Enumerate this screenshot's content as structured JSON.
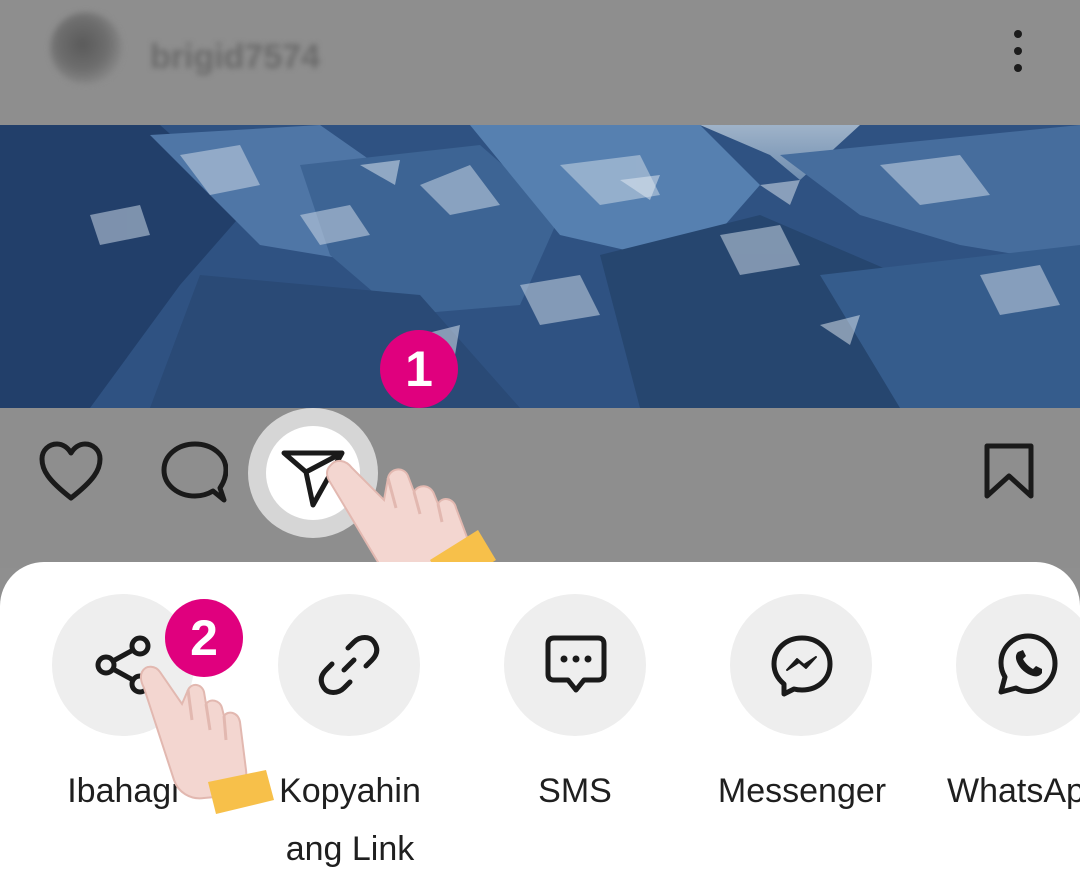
{
  "post": {
    "username": "brigid7574"
  },
  "badges": {
    "step1": "1",
    "step2": "2"
  },
  "share_sheet": {
    "options": [
      {
        "label": "Ibahagi",
        "icon": "share-icon"
      },
      {
        "label": "Kopyahin ang Link",
        "line1": "Kopyahin",
        "line2": "ang Link",
        "icon": "link-icon"
      },
      {
        "label": "SMS",
        "icon": "sms-icon"
      },
      {
        "label": "Messenger",
        "icon": "messenger-icon"
      },
      {
        "label": "WhatsAp",
        "icon": "whatsapp-icon"
      }
    ]
  },
  "colors": {
    "badge": "#e0007e",
    "dim_overlay": "#8e8e8e",
    "hand_cuff": "#f7c04a"
  }
}
